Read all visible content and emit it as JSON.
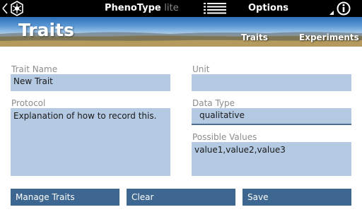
{
  "app": {
    "title_main": "PhenoType",
    "title_suffix": "lite",
    "options_label": "Options"
  },
  "banner": {
    "page_title": "Traits",
    "tabs": [
      {
        "label": "Traits"
      },
      {
        "label": "Experiments"
      }
    ]
  },
  "form": {
    "trait_name": {
      "label": "Trait Name",
      "value": "New Trait"
    },
    "unit": {
      "label": "Unit",
      "value": ""
    },
    "protocol": {
      "label": "Protocol",
      "value": "Explanation of how to record this."
    },
    "data_type": {
      "label": "Data Type",
      "value": "qualitative"
    },
    "possible_values": {
      "label": "Possible Values",
      "value": "value1,value2,value3"
    }
  },
  "buttons": {
    "manage_traits": "Manage Traits",
    "clear": "Clear",
    "save": "Save"
  },
  "icons": {
    "app": "hexagon-logo-icon",
    "menu": "list-menu-icon",
    "info": "info-icon"
  },
  "colors": {
    "field_bg": "#b4c9e2",
    "button_bg": "#3d6690",
    "label": "#8c8c8c"
  }
}
